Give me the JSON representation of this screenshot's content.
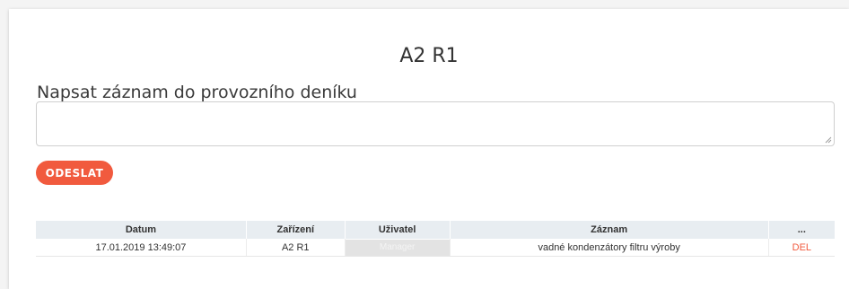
{
  "page": {
    "title": "A2 R1",
    "subtitle": "Napsat záznam do provozního deníku"
  },
  "form": {
    "entry_value": "",
    "submit_label": "ODESLAT"
  },
  "colors": {
    "accent": "#f15a3e",
    "table_header_bg": "#e8edf1"
  },
  "table": {
    "headers": {
      "date": "Datum",
      "device": "Zařízení",
      "user": "Uživatel",
      "entry": "Záznam",
      "actions": "..."
    },
    "rows": [
      {
        "date": "17.01.2019 13:49:07",
        "device": "A2 R1",
        "user": "Manager",
        "entry": "vadné kondenzátory filtru výroby",
        "action": "DEL"
      }
    ]
  }
}
